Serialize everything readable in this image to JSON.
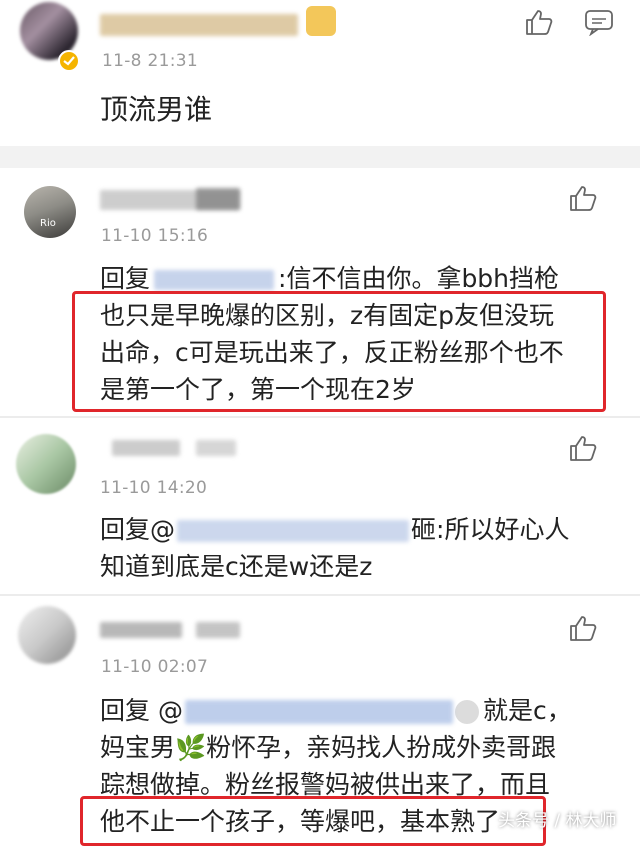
{
  "comments": [
    {
      "time": "11-8 21:31",
      "lines": [
        "顶流男谁"
      ]
    },
    {
      "time": "11-10 15:16",
      "avatar_text": "Rio",
      "lines": [
        "回复",
        ":信不信由你。拿bbh挡枪",
        "也只是早晚爆的区别，z有固定p友但没玩",
        "出命，c可是玩出来了，反正粉丝那个也不",
        "是第一个了，第一个现在2岁"
      ]
    },
    {
      "time": "11-10 14:20",
      "lines": [
        "回复@",
        "砸:所以好心人",
        "知道到底是c还是w还是z"
      ]
    },
    {
      "time": "11-10 02:07",
      "lines": [
        "回复 @",
        "就是c，",
        "妈宝男🌿粉怀孕，亲妈找人扮成外卖哥跟",
        "踪想做掉。粉丝报警妈被供出来了，而且",
        "他不止一个孩子，等爆吧，基本熟了"
      ]
    }
  ],
  "watermark": "头条号 / 林大师",
  "icons": {
    "like": "thumbs-up-icon",
    "comment": "comment-icon",
    "verified": "verified-badge-icon",
    "vip": "vip-badge-icon"
  },
  "colors": {
    "highlight_box": "#e0262b",
    "time": "#9a9a9a",
    "separator": "#f2f2f2"
  }
}
